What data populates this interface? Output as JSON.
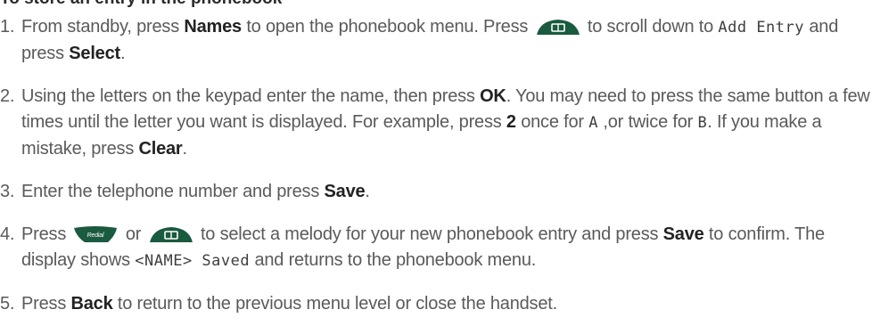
{
  "heading": "To store an entry in the phonebook",
  "icons": {
    "book_key": "phonebook-key-icon",
    "redial_key": "redial-key-icon",
    "redial_label": "Redial",
    "key_color": "#1a5a3e"
  },
  "steps": [
    {
      "num": "1.",
      "t1": "From standby, press ",
      "b1": "Names",
      "t2": " to open the phonebook menu. Press ",
      "t3": " to scroll down to ",
      "lcd1": "Add Entry",
      "t4": " and press ",
      "b2": "Select",
      "t5": "."
    },
    {
      "num": "2.",
      "t1": "Using the letters on the keypad enter the name, then press ",
      "b1": "OK",
      "t2": ". You may need to press the same button a few times until the letter you want is displayed. For example, press ",
      "b2": "2",
      "t3": " once for ",
      "lcd1": "A",
      "t4": " ,or twice for ",
      "lcd2": "B",
      "t5": ". If you make a mistake, press ",
      "b3": "Clear",
      "t6": "."
    },
    {
      "num": "3.",
      "t1": "Enter the telephone number and press ",
      "b1": "Save",
      "t2": "."
    },
    {
      "num": "4.",
      "t1": "Press ",
      "t2": " or ",
      "t3": " to select a melody for your new phonebook entry and press ",
      "b1": "Save",
      "t4": " to confirm. The display shows ",
      "lcd1": "<NAME> Saved",
      "t5": " and returns to the phonebook menu."
    },
    {
      "num": "5.",
      "t1": "Press ",
      "b1": "Back",
      "t2": " to return to the previous menu level or close the handset."
    }
  ]
}
